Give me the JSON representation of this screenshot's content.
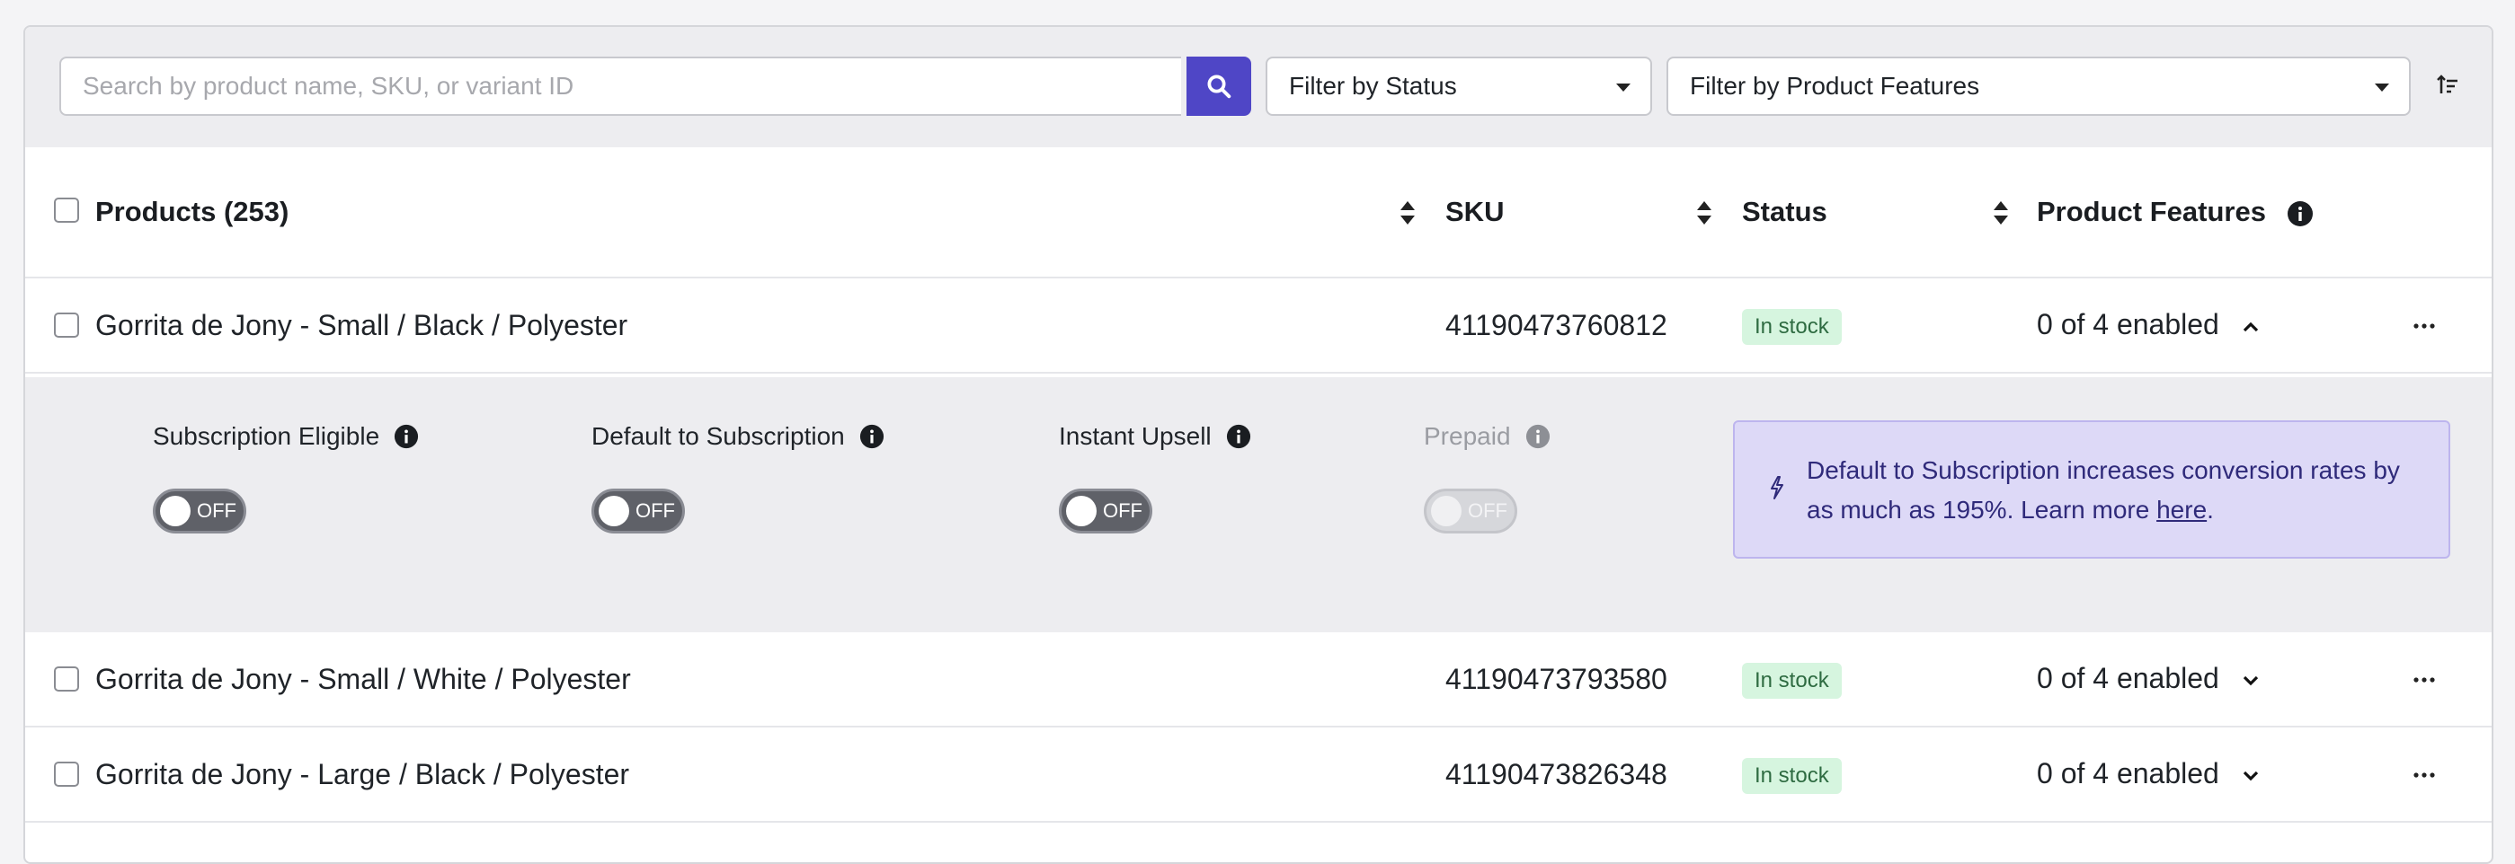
{
  "toolbar": {
    "search_placeholder": "Search by product name, SKU, or variant ID",
    "filter_status": "Filter by Status",
    "filter_features": "Filter by Product Features"
  },
  "table": {
    "headers": {
      "products": "Products (253)",
      "sku": "SKU",
      "status": "Status",
      "features": "Product Features"
    },
    "rows": [
      {
        "name": "Gorrita de Jony - Small / Black / Polyester",
        "sku": "41190473760812",
        "status": "In stock",
        "features": "0 of 4 enabled",
        "expanded": true
      },
      {
        "name": "Gorrita de Jony - Small / White / Polyester",
        "sku": "41190473793580",
        "status": "In stock",
        "features": "0 of 4 enabled",
        "expanded": false
      },
      {
        "name": "Gorrita de Jony - Large / Black / Polyester",
        "sku": "41190473826348",
        "status": "In stock",
        "features": "0 of 4 enabled",
        "expanded": false
      }
    ]
  },
  "expanded": {
    "features": [
      {
        "label": "Subscription Eligible",
        "state": "OFF",
        "disabled": false
      },
      {
        "label": "Default to Subscription",
        "state": "OFF",
        "disabled": false
      },
      {
        "label": "Instant Upsell",
        "state": "OFF",
        "disabled": false
      },
      {
        "label": "Prepaid",
        "state": "OFF",
        "disabled": true
      }
    ],
    "promo": {
      "text": "Default to Subscription increases conversion rates by as much as 195%. Learn more ",
      "link": "here",
      "suffix": "."
    }
  },
  "colors": {
    "accent": "#4f46c6",
    "badge_bg": "#d6f5df",
    "badge_text": "#2e6b41",
    "promo_bg": "#ddd9f7"
  }
}
